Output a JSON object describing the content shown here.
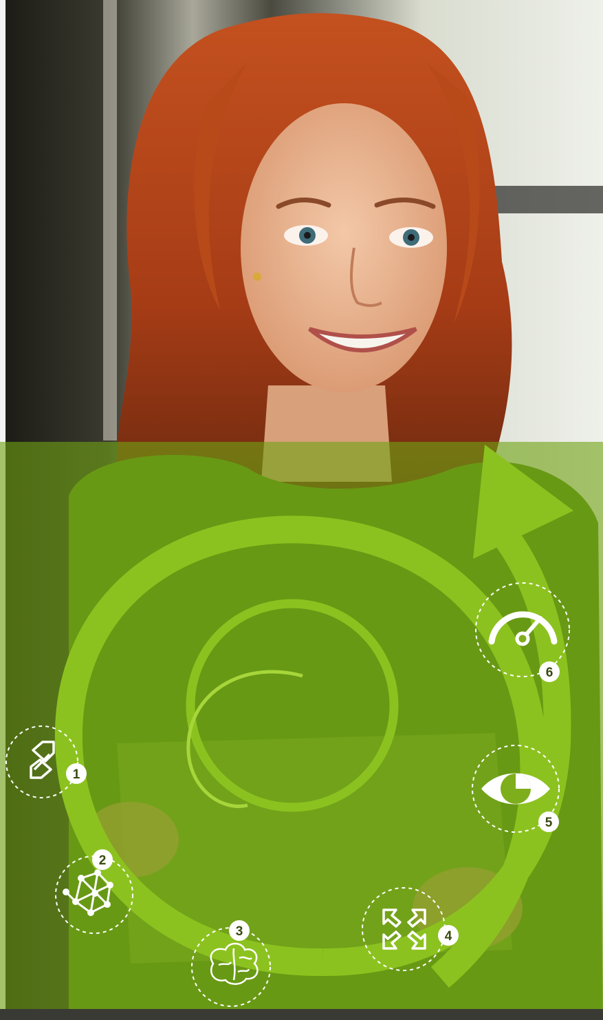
{
  "colors": {
    "accent": "#8cc21f",
    "accent_light": "#a6d63a",
    "overlay": "#6a9a10",
    "hair": "#b5461c",
    "skin": "#e9b08f",
    "shirt": "#5f8a1a"
  },
  "steps": [
    {
      "number": "1",
      "icon": "expand-arrows-icon"
    },
    {
      "number": "2",
      "icon": "network-nodes-icon"
    },
    {
      "number": "3",
      "icon": "brain-icon"
    },
    {
      "number": "4",
      "icon": "collapse-arrows-icon"
    },
    {
      "number": "5",
      "icon": "eye-chart-icon"
    },
    {
      "number": "6",
      "icon": "speedometer-icon"
    }
  ]
}
